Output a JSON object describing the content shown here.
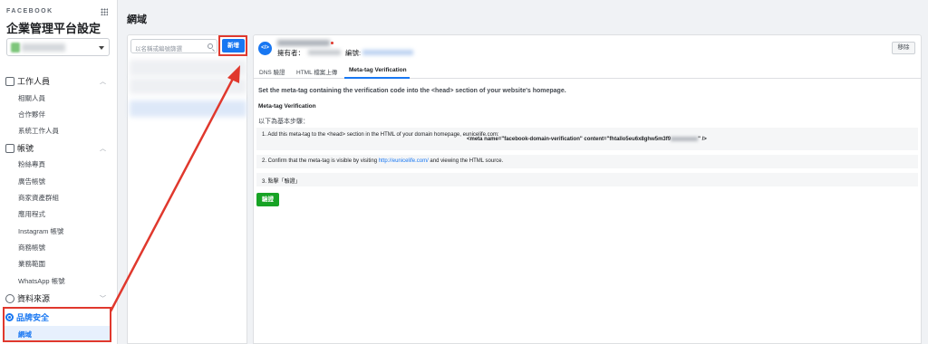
{
  "nav": {
    "brand": "FACEBOOK",
    "title": "企業管理平台設定",
    "sections": [
      {
        "label": "工作人員",
        "items": [
          "相關人員",
          "合作夥伴",
          "系統工作人員"
        ]
      },
      {
        "label": "帳號",
        "items": [
          "粉絲專頁",
          "廣告帳號",
          "商家資產群組",
          "應用程式",
          "Instagram 帳號",
          "商務帳號",
          "業務範圍",
          "WhatsApp 帳號"
        ]
      },
      {
        "label": "資料來源",
        "items": []
      },
      {
        "label": "品牌安全",
        "items": [
          "網域"
        ]
      }
    ]
  },
  "page": {
    "title": "網域"
  },
  "list": {
    "search_placeholder": "以名稱或編號篩選",
    "add_label": "新增"
  },
  "main": {
    "badge": "</>",
    "owner_label": "擁有者：",
    "id_label": "編號:",
    "remove_label": "移除",
    "tabs": [
      "DNS 驗證",
      "HTML 檔案上傳",
      "Meta-tag Verification"
    ],
    "intro": "Set the meta-tag containing the verification code into the <head> section of your website's homepage.",
    "mt_title": "Meta-tag Verification",
    "steps_label": "以下為基本步驟：",
    "step1": "1. Add this meta-tag to the <head> section in the HTML of your domain homepage, eunicelife.com:",
    "code_prefix": "<meta name=\"facebook-domain-verification\" content=\"fhtallo5eu6x8ghw5m3f9",
    "code_suffix": "\" />",
    "step2_prefix": "2. Confirm that the meta-tag is visible by visiting ",
    "step2_link": "http://eunicelife.com/",
    "step2_suffix": " and viewing the HTML source.",
    "step3": "3. 點擊「驗證」",
    "verify_label": "驗證"
  },
  "colors": {
    "accent": "#1877f2",
    "highlight": "#e0382d",
    "verify": "#17a325"
  }
}
